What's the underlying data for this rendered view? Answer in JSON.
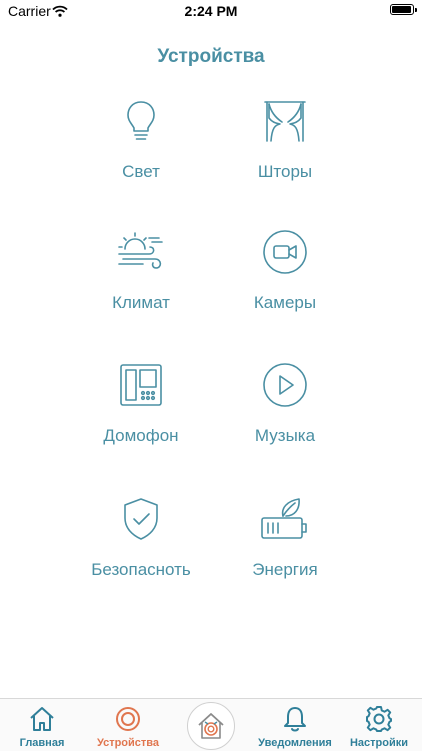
{
  "status_bar": {
    "carrier": "Carrier",
    "time": "2:24 PM",
    "battery_level": 1.0
  },
  "header": {
    "title": "Устройства"
  },
  "devices": [
    {
      "label": "Свет",
      "icon": "lightbulb-icon"
    },
    {
      "label": "Шторы",
      "icon": "curtains-icon"
    },
    {
      "label": "Климат",
      "icon": "climate-icon"
    },
    {
      "label": "Камеры",
      "icon": "camera-icon"
    },
    {
      "label": "Домофон",
      "icon": "intercom-icon"
    },
    {
      "label": "Музыка",
      "icon": "play-icon"
    },
    {
      "label": "Безопасноть",
      "icon": "shield-check-icon"
    },
    {
      "label": "Энергия",
      "icon": "battery-leaf-icon"
    }
  ],
  "tabbar": {
    "tabs": [
      {
        "label": "Главная",
        "icon": "home-icon"
      },
      {
        "label": "Устройства",
        "icon": "devices-ring-icon",
        "active": true
      },
      {
        "label": "",
        "icon": "house-logo-icon"
      },
      {
        "label": "Уведомления",
        "icon": "bell-icon"
      },
      {
        "label": "Настройки",
        "icon": "gear-icon"
      }
    ]
  },
  "colors": {
    "accent": "#4a8fa3",
    "active_tab": "#e0764f",
    "tab_label": "#2f7f99"
  }
}
